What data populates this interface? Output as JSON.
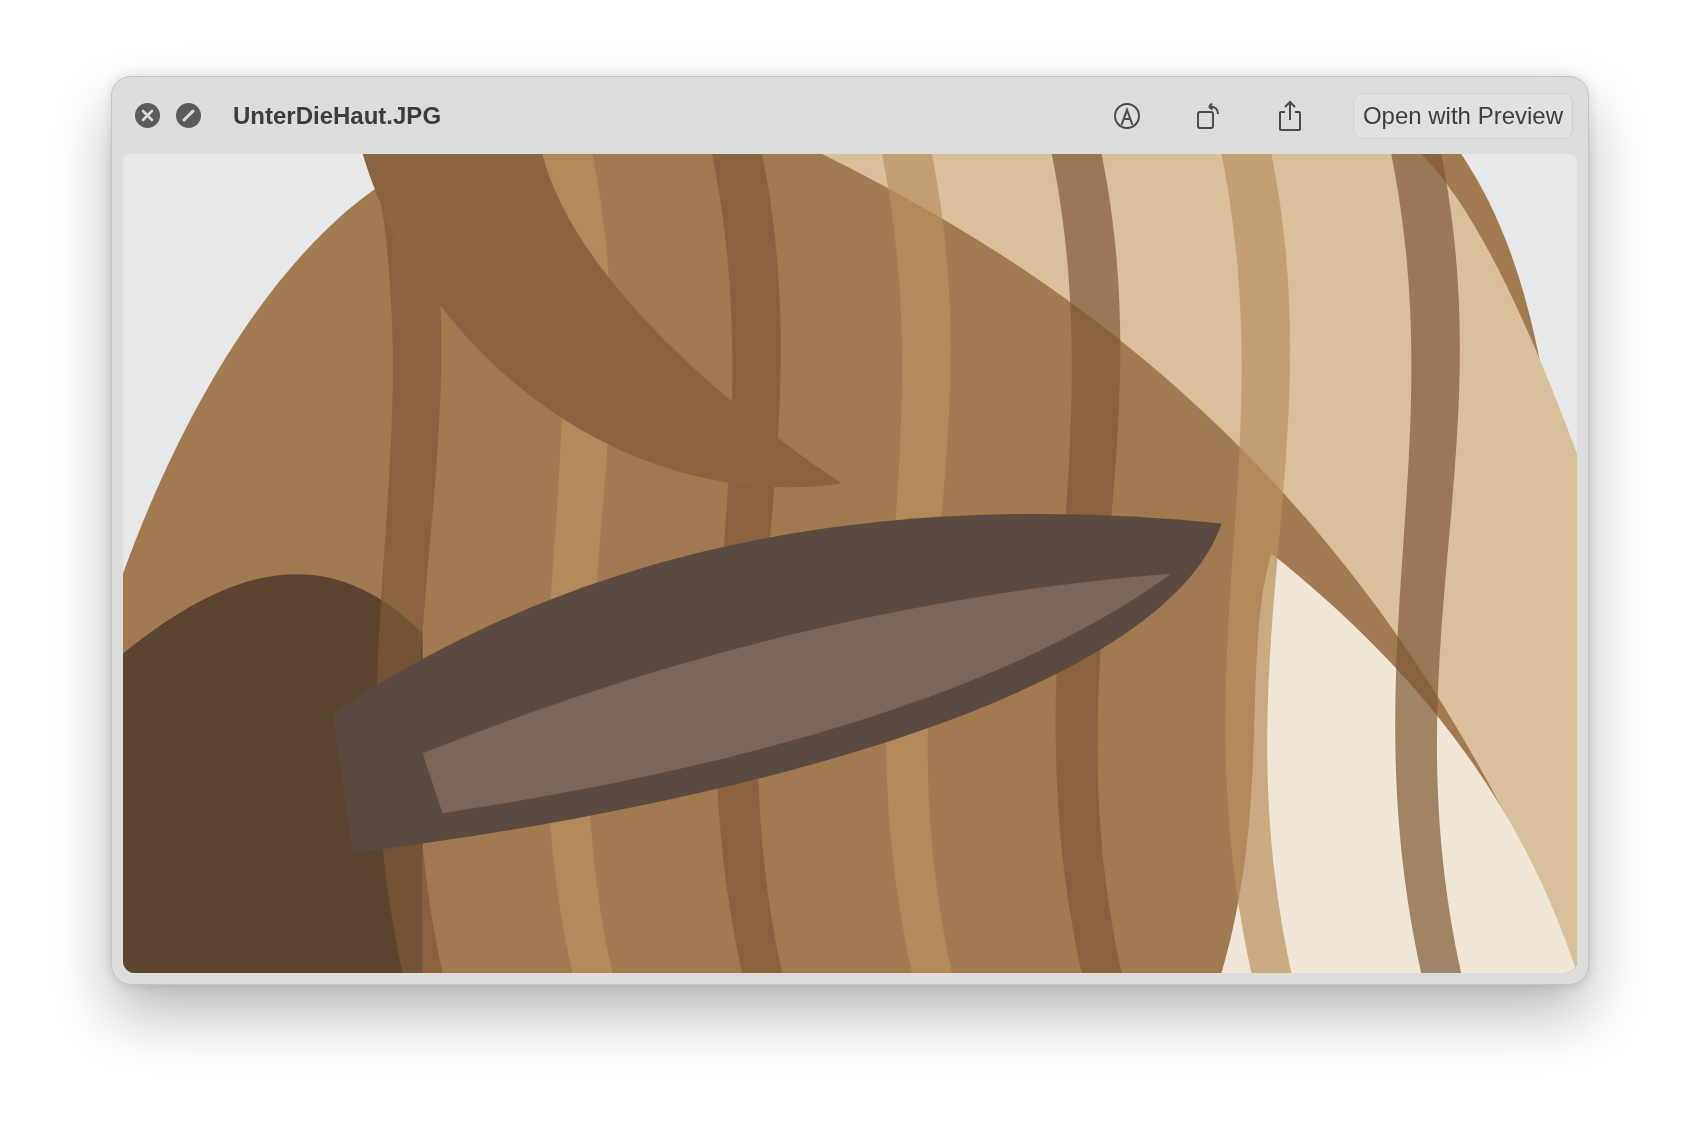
{
  "window": {
    "title": "UnterDieHaut.JPG"
  },
  "toolbar": {
    "open_button": "Open with Preview"
  }
}
